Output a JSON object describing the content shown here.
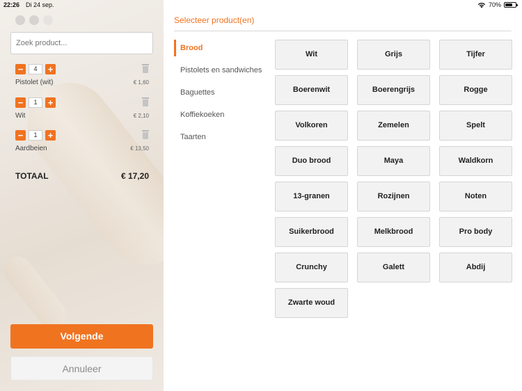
{
  "status_bar": {
    "time": "22:26",
    "date": "Di 24 sep.",
    "battery": "70%",
    "battery_level": 0.7
  },
  "search": {
    "placeholder": "Zoek product..."
  },
  "cart": {
    "items": [
      {
        "qty": "4",
        "name": "Pistolet (wit)",
        "price": "€ 1,60",
        "note": ""
      },
      {
        "qty": "1",
        "name": "Wit",
        "price": "€ 2,10",
        "note": ""
      },
      {
        "qty": "1",
        "name": "Aardbeien",
        "price": "€ 13,50",
        "note": ""
      }
    ],
    "minus": "−",
    "plus": "+",
    "total_label": "TOTAAL",
    "total_value": "€ 17,20"
  },
  "buttons": {
    "next": "Volgende",
    "cancel": "Annuleer"
  },
  "title": "Selecteer product(en)",
  "categories": [
    "Brood",
    "Pistolets en sandwiches",
    "Baguettes",
    "Koffiekoeken",
    "Taarten"
  ],
  "products": [
    "Wit",
    "Grijs",
    "Tijfer",
    "Boerenwit",
    "Boerengrijs",
    "Rogge",
    "Volkoren",
    "Zemelen",
    "Spelt",
    "Duo brood",
    "Maya",
    "Waldkorn",
    "13-granen",
    "Rozijnen",
    "Noten",
    "Suikerbrood",
    "Melkbrood",
    "Pro body",
    "Crunchy",
    "Galett",
    "Abdij",
    "Zwarte woud"
  ],
  "colors": {
    "accent": "#f07320"
  }
}
